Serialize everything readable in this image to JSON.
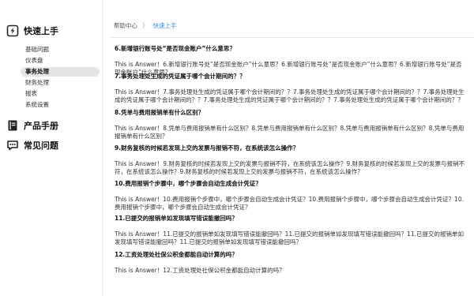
{
  "sidebar": {
    "quick_start": {
      "title": "快速上手",
      "items": [
        {
          "label": "基础问题"
        },
        {
          "label": "仪表盘"
        },
        {
          "label": "事务处理",
          "active": true
        },
        {
          "label": "财务处理"
        },
        {
          "label": "报表"
        },
        {
          "label": "系统设置"
        }
      ]
    },
    "manual": {
      "title": "产品手册"
    },
    "faq": {
      "title": "常见问题"
    }
  },
  "breadcrumb": {
    "home": "帮助中心",
    "current": "快速上手"
  },
  "qa": [
    {
      "q": "6.新增银行账号处”是否现金账户”什么意思？",
      "a": "This is Answer！6.新增银行账号处”是否现金账户”什么意思？6.新增银行账号处”是否现金账户”什么意思？6.新增银行账号处”是否现金账户”什么意思？"
    },
    {
      "q": "7.事务处理处生成的凭证属于哪个会计期间的？？",
      "a": "This is Answer！7.事务处理处生成的凭证属于哪个会计期间的？？7.事务处理处生成的凭证属于哪个会计期间的？？7.事务处理处生成的凭证属于哪个会计期间的？？7.事务处理处生成的凭证属于哪个会计期间的？？7.事务处理处生成的凭证属于哪个会计期间的？？"
    },
    {
      "q": "8.凭单与费用报销单有什么区别？",
      "a": "This is Answer！8.凭单与费用报销单有什么区别？8.凭单与费用报销单有什么区别？8.凭单与费用报销单有什么区别？8.凭单与费用报销单有什么区别？"
    },
    {
      "q": "9.财务复核的时候若发现上交的发票与报销不符，在系统该怎么操作？",
      "a": "This is Answer！9.财务复核的时候若发现上交的发票与报销不符，在系统该怎么操作？9.财务复核的时候若发现上交的发票与报销不符，在系统该怎么操作？9.财务复核的时候若发现上交的发票与报销不符，在系统该怎么操作？"
    },
    {
      "q": "10.费用报销个步骤中，哪个步骤会自动生成会计凭证？",
      "a": "This is Answer！10.费用报销个步骤中，哪个步骤会自动生成会计凭证？10.费用报销个步骤中，哪个步骤会自动生成会计凭证？10.费用报销个步骤中，哪个步骤会自动生成会计凭证？"
    },
    {
      "q": "11.已提交的报销单如发现填写错误能撤回吗？",
      "a": "This is Answer！11.已提交的报销单如发现填写错误能撤回吗？11.已提交的报销单如发现填写错误能撤回吗？11.已提交的报销单如发现填写错误能撤回吗？11.已提交的报销单如发现填写错误能撤回吗？"
    },
    {
      "q": "12.工资处理处社保公积金都能自动计算的吗？",
      "a": "This is Answer！12.工资处理处社保公积金都能自动计算的吗？"
    }
  ]
}
